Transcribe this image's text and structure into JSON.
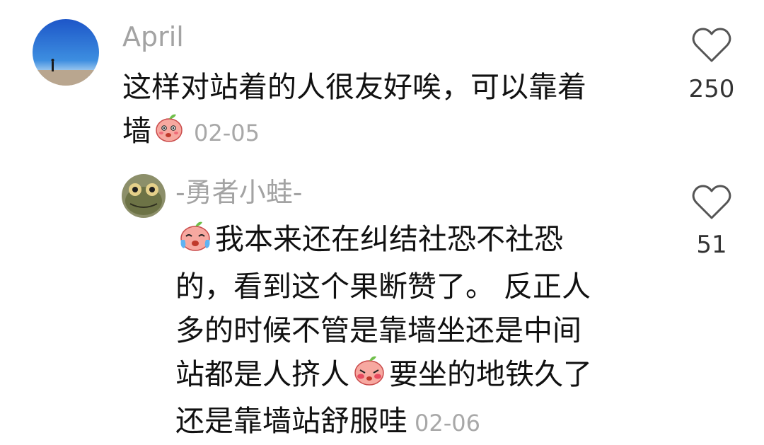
{
  "comments": [
    {
      "username": "April",
      "text_line1": "这样对站着的人很友好唉，可以靠着",
      "text_line2_prefix": "墙",
      "date": "02-05",
      "likes": "250",
      "emoji_name": "peach-face-emoji"
    }
  ],
  "reply": {
    "username": "-勇者小蛙-",
    "line1": "我本来还在纠结社恐不社恐",
    "line2": "的，看到这个果断赞了。 反正人",
    "line3": "多的时候不管是靠墙坐还是中间",
    "line4_a": "站都是人挤人",
    "line4_b": "要坐的地铁久了",
    "line5": "还是靠墙站舒服哇",
    "date": "02-06",
    "likes": "51"
  },
  "icons": {
    "like": "heart-outline-icon"
  },
  "colors": {
    "username": "#a3a3a3",
    "text": "#111111",
    "date": "#a8a8a8"
  }
}
